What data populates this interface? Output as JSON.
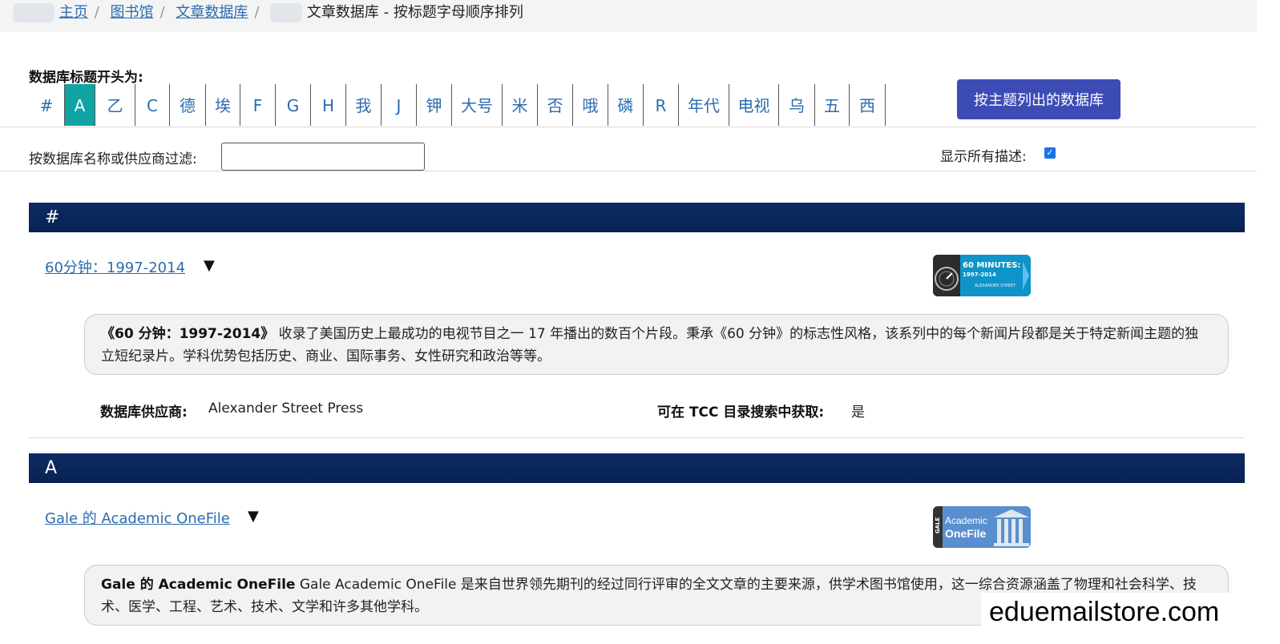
{
  "breadcrumb": {
    "items": [
      "主页",
      "图书馆",
      "文章数据库"
    ],
    "current": "文章数据库 - 按标题字母顺序排列"
  },
  "alpha": {
    "label": "数据库标题开头为:",
    "letters": [
      "#",
      "A",
      "乙",
      "C",
      "德",
      "埃",
      "F",
      "G",
      "H",
      "我",
      "J",
      "钾",
      "大号",
      "米",
      "否",
      "哦",
      "磷",
      "R",
      "年代",
      "电视",
      "乌",
      "五",
      "西"
    ],
    "active": "A"
  },
  "subject_button": "按主题列出的数据库",
  "filter": {
    "label": "按数据库名称或供应商过滤:",
    "value": "",
    "show_all_label": "显示所有描述:",
    "show_all_checked": true
  },
  "sections": [
    {
      "heading": "#",
      "entry": {
        "title": "60分钟：1997-2014",
        "toggle": "▼",
        "logo": {
          "line1": "60 MINUTES:",
          "line2": "1997-2014",
          "line3": "ALEXANDER STREET"
        },
        "desc_bold": "《60 分钟：1997-2014》",
        "desc_text": " 收录了美国历史上最成功的电视节目之一 17 年播出的数百个片段。秉承《60 分钟》的标志性风格，该系列中的每个新闻片段都是关于特定新闻主题的独立短纪录片。学科优势包括历史、商业、国际事务、女性研究和政治等等。",
        "vendor_label": "数据库供应商:",
        "vendor_value": "Alexander Street Press",
        "tcc_label": "可在 TCC 目录搜索中获取:",
        "tcc_value": "是"
      }
    },
    {
      "heading": "A",
      "entry": {
        "title": "Gale 的 Academic OneFile",
        "toggle": "▼",
        "logo": {
          "side": "GALE",
          "line1": "Academic",
          "line2": "OneFile"
        },
        "desc_bold": "Gale 的 Academic OneFile",
        "desc_text": " Gale Academic OneFile 是来自世界领先期刊的经过同行评审的全文文章的主要来源，供学术图书馆使用，这一综合资源涵盖了物理和社会科学、技术、医学、工程、艺术、技术、文学和许多其他学科。"
      }
    }
  ],
  "watermark": "eduemailstore.com",
  "colors": {
    "link": "#2b6cb0",
    "active_letter_bg": "#10a3a3",
    "subject_button_bg": "#3d4cb5",
    "section_bar_bg": "#0d2b63"
  }
}
